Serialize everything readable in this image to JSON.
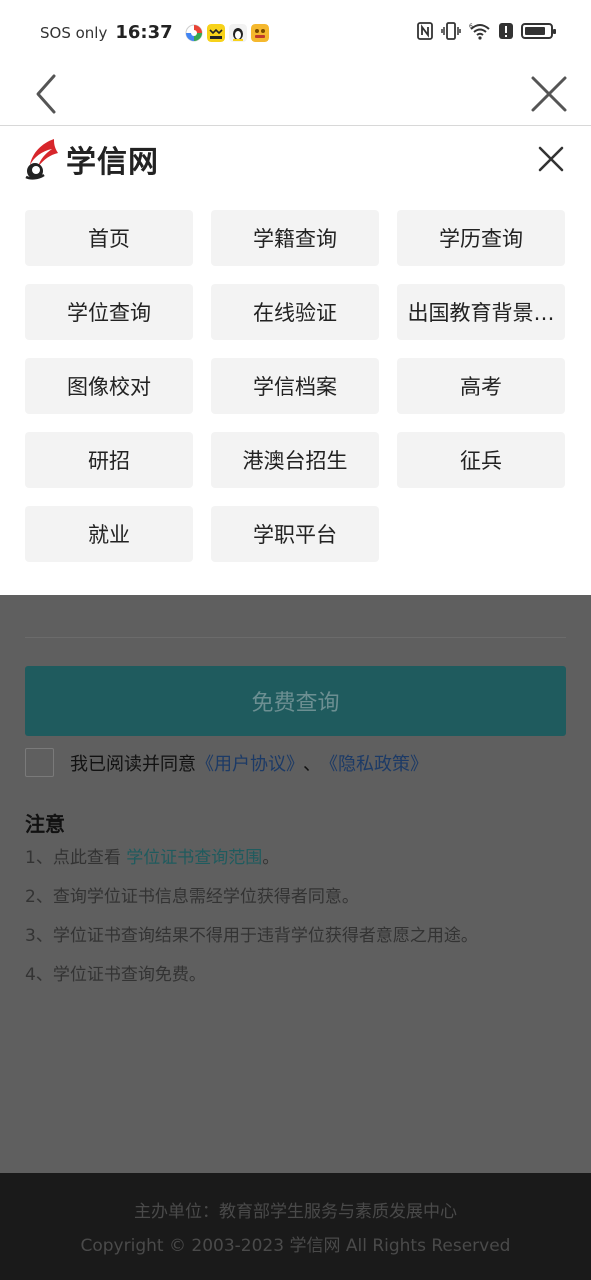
{
  "status_bar": {
    "carrier": "SOS only",
    "time": "16:37",
    "app_icons": [
      "browser-app-icon",
      "cartoon-app-icon",
      "penguin-app-icon",
      "yellow-app-icon"
    ],
    "battery_level": 0.85,
    "icons": [
      "nfc-icon",
      "vibrate-icon",
      "wifi-icon",
      "alert-icon",
      "battery-icon"
    ]
  },
  "nav": {
    "back_icon": "chevron-left-icon",
    "close_icon": "close-icon"
  },
  "menu": {
    "logo_text": "学信网",
    "items": [
      {
        "label": "首页"
      },
      {
        "label": "学籍查询"
      },
      {
        "label": "学历查询"
      },
      {
        "label": "学位查询"
      },
      {
        "label": "在线验证"
      },
      {
        "label": "出国教育背景…"
      },
      {
        "label": "图像校对"
      },
      {
        "label": "学信档案"
      },
      {
        "label": "高考"
      },
      {
        "label": "研招"
      },
      {
        "label": "港澳台招生"
      },
      {
        "label": "征兵"
      },
      {
        "label": "就业"
      },
      {
        "label": "学职平台"
      }
    ]
  },
  "page": {
    "query_button": "免费查询",
    "agree_prefix": "我已阅读并同意",
    "user_agreement": "《用户协议》",
    "separator": "、",
    "privacy_policy": "《隐私政策》",
    "notice_title": "注意",
    "notice_1_prefix": "1、点此查看 ",
    "notice_1_link": "学位证书查询范围",
    "notice_1_suffix": "。",
    "notice_2": "2、查询学位证书信息需经学位获得者同意。",
    "notice_3": "3、学位证书查询结果不得用于违背学位获得者意愿之用途。",
    "notice_4": "4、学位证书查询免费。"
  },
  "footer": {
    "line1": "主办单位：教育部学生服务与素质发展中心",
    "line2": "Copyright © 2003-2023 学信网 All Rights Reserved"
  },
  "colors": {
    "accent": "#1f5b5e",
    "overlay": "#5f5f5f",
    "menu_button_bg": "#f3f3f3",
    "logo_red": "#d7262b"
  }
}
